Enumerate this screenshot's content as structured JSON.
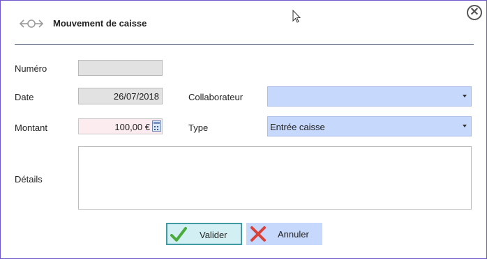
{
  "dialog": {
    "title": "Mouvement de caisse",
    "header_icon": "exchange-arrows-icon",
    "close_icon": "close-circle-icon",
    "close_glyph": "✕"
  },
  "form": {
    "numero": {
      "label": "Numéro",
      "value": ""
    },
    "date": {
      "label": "Date",
      "value": "26/07/2018"
    },
    "collaborateur": {
      "label": "Collaborateur",
      "value": ""
    },
    "montant": {
      "label": "Montant",
      "value": "100,00 €",
      "icon": "calculator-icon"
    },
    "type": {
      "label": "Type",
      "value": "Entrée caisse"
    },
    "details": {
      "label": "Détails",
      "value": ""
    }
  },
  "actions": {
    "validate": {
      "label": "Valider",
      "icon": "checkmark-icon",
      "color": "#4aaa3c"
    },
    "cancel": {
      "label": "Annuler",
      "icon": "cross-icon",
      "color": "#d9413a"
    }
  },
  "colors": {
    "accent_border": "#6e56c8",
    "separator": "#3c4c68",
    "select_bg": "#c6d8fb",
    "readonly_bg": "#e2e2e2",
    "montant_bg": "#fdecef",
    "validate_bg": "#d2f0f3",
    "validate_border": "#3f9aa2"
  }
}
